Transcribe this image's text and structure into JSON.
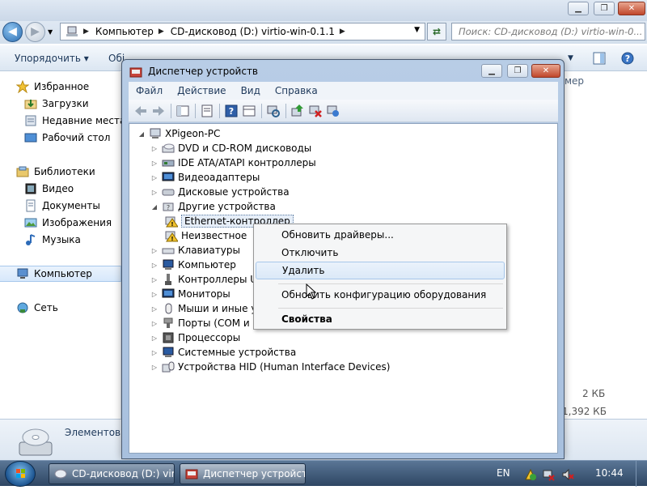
{
  "explorer": {
    "address": [
      "Компьютер",
      "CD-дисковод (D:) virtio-win-0.1.1"
    ],
    "search_placeholder": "Поиск: CD-дисковод (D:) virtio-win-0...",
    "cmd_organize": "Упорядочить",
    "cmd_partial": "Обі",
    "column_partial": "мер",
    "nav": {
      "favorites": "Избранное",
      "downloads": "Загрузки",
      "recent": "Недавние места",
      "desktop": "Рабочий стол",
      "libraries": "Библиотеки",
      "videos": "Видео",
      "documents": "Документы",
      "pictures": "Изображения",
      "music": "Музыка",
      "computer": "Компьютер",
      "network": "Сеть"
    },
    "size1": "2 КБ",
    "size2": "1,392 КБ",
    "status_label": "Элементов:"
  },
  "devmgr": {
    "title": "Диспетчер устройств",
    "menu": [
      "Файл",
      "Действие",
      "Вид",
      "Справка"
    ],
    "tree": {
      "root": "XPigeon-PC",
      "dvd": "DVD и CD-ROM дисководы",
      "ide": "IDE ATA/ATAPI контроллеры",
      "video": "Видеоадаптеры",
      "disk": "Дисковые устройства",
      "other": "Другие устройства",
      "ethernet": "Ethernet-контроллер",
      "unknown": "Неизвестное",
      "keyboards": "Клавиатуры",
      "computer": "Компьютер",
      "usb": "Контроллеры US",
      "monitors": "Мониторы",
      "mice": "Мыши и иные ук",
      "ports": "Порты (COM и L",
      "cpu": "Процессоры",
      "system": "Системные устройства",
      "hid": "Устройства HID (Human Interface Devices)"
    }
  },
  "context_menu": {
    "update": "Обновить драйверы...",
    "disable": "Отключить",
    "uninstall": "Удалить",
    "scan": "Обновить конфигурацию оборудования",
    "properties": "Свойства"
  },
  "taskbar": {
    "task1": "CD-дисковод (D:) vir...",
    "task2": "Диспетчер устройств",
    "lang": "EN",
    "clock": "10:44"
  }
}
